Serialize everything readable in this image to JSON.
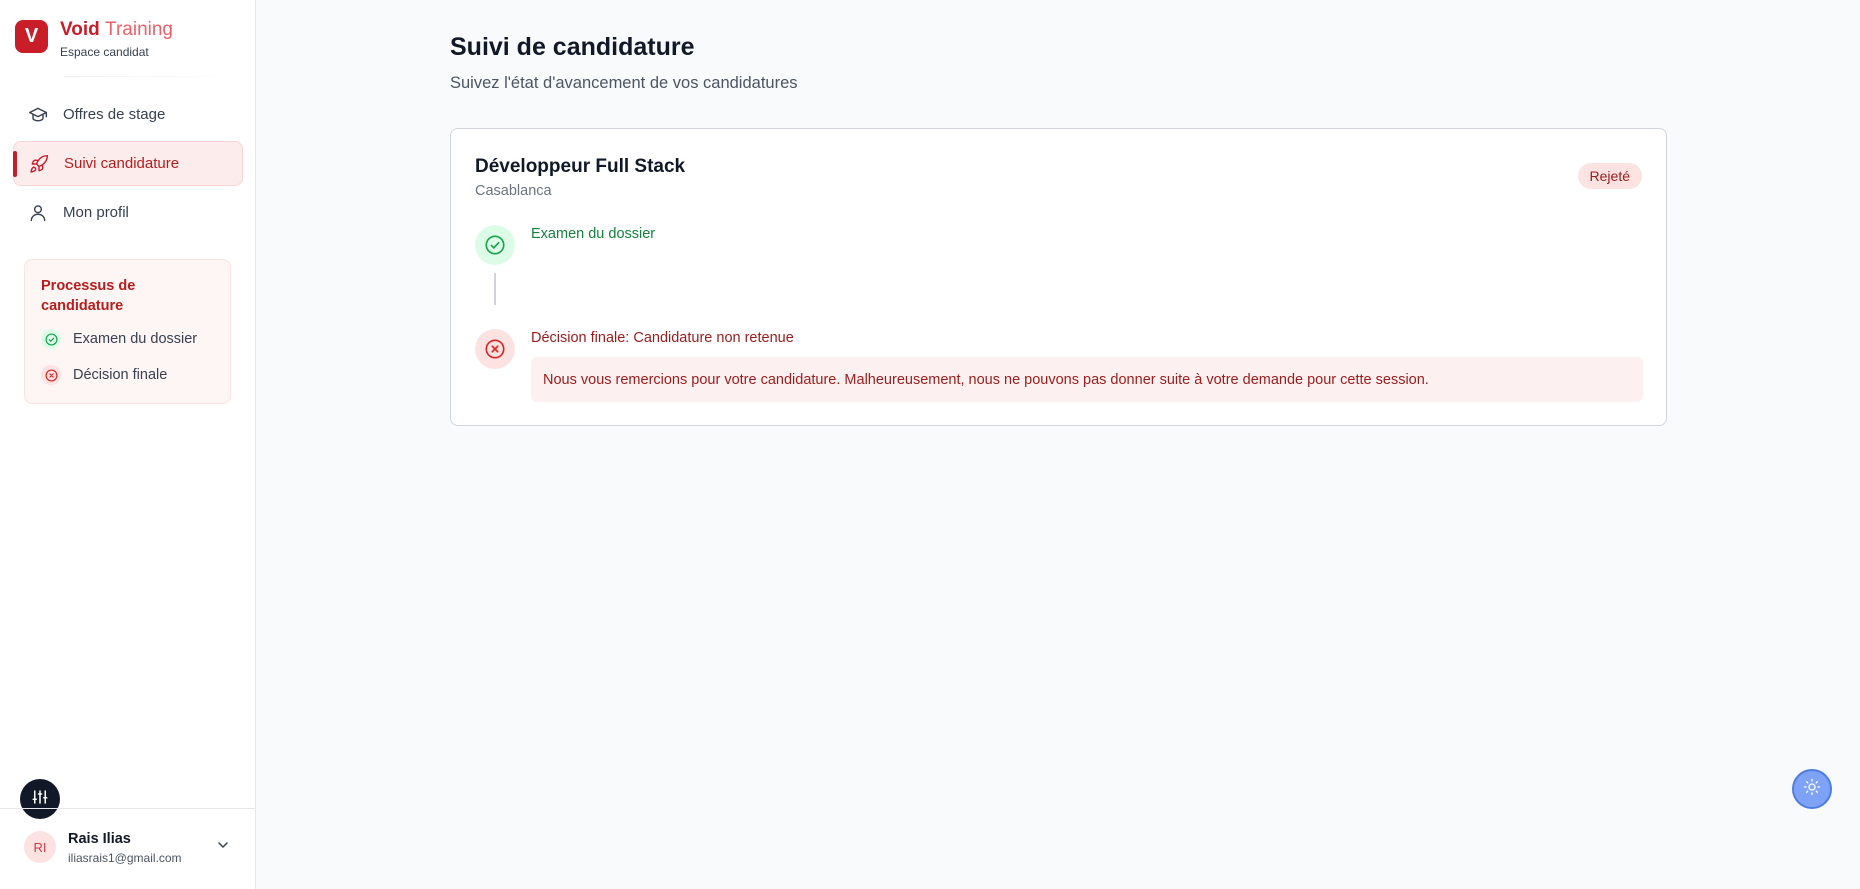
{
  "brand": {
    "logo_letter": "V",
    "name_part1": "Void",
    "name_part2": "Training",
    "subtitle": "Espace candidat"
  },
  "nav": {
    "items": [
      {
        "label": "Offres de stage",
        "icon": "graduation-cap-icon",
        "active": false
      },
      {
        "label": "Suivi candidature",
        "icon": "rocket-icon",
        "active": true
      },
      {
        "label": "Mon profil",
        "icon": "user-icon",
        "active": false
      }
    ]
  },
  "process": {
    "title": "Processus de candidature",
    "steps": [
      {
        "label": "Examen du dossier",
        "status": "success",
        "icon": "check-circle-icon"
      },
      {
        "label": "Décision finale",
        "status": "rejected",
        "icon": "x-circle-icon"
      }
    ]
  },
  "user": {
    "initials": "RI",
    "name": "Rais Ilias",
    "email": "iliasrais1@gmail.com"
  },
  "main": {
    "title": "Suivi de candidature",
    "subtitle": "Suivez l'état d'avancement de vos candidatures"
  },
  "application": {
    "job_title": "Développeur Full Stack",
    "city": "Casablanca",
    "status": "Rejeté",
    "timeline": [
      {
        "label": "Examen du dossier",
        "status": "success"
      },
      {
        "label": "Décision finale: Candidature non retenue",
        "status": "rejected",
        "message": "Nous vous remercions pour votre candidature. Malheureusement, nous ne pouvons pas donner suite à votre demande pour cette session."
      }
    ]
  },
  "colors": {
    "brand": "#c81e2a",
    "success": "#16a34a",
    "danger": "#dc2626",
    "theme_button": "#7ea2f6"
  }
}
